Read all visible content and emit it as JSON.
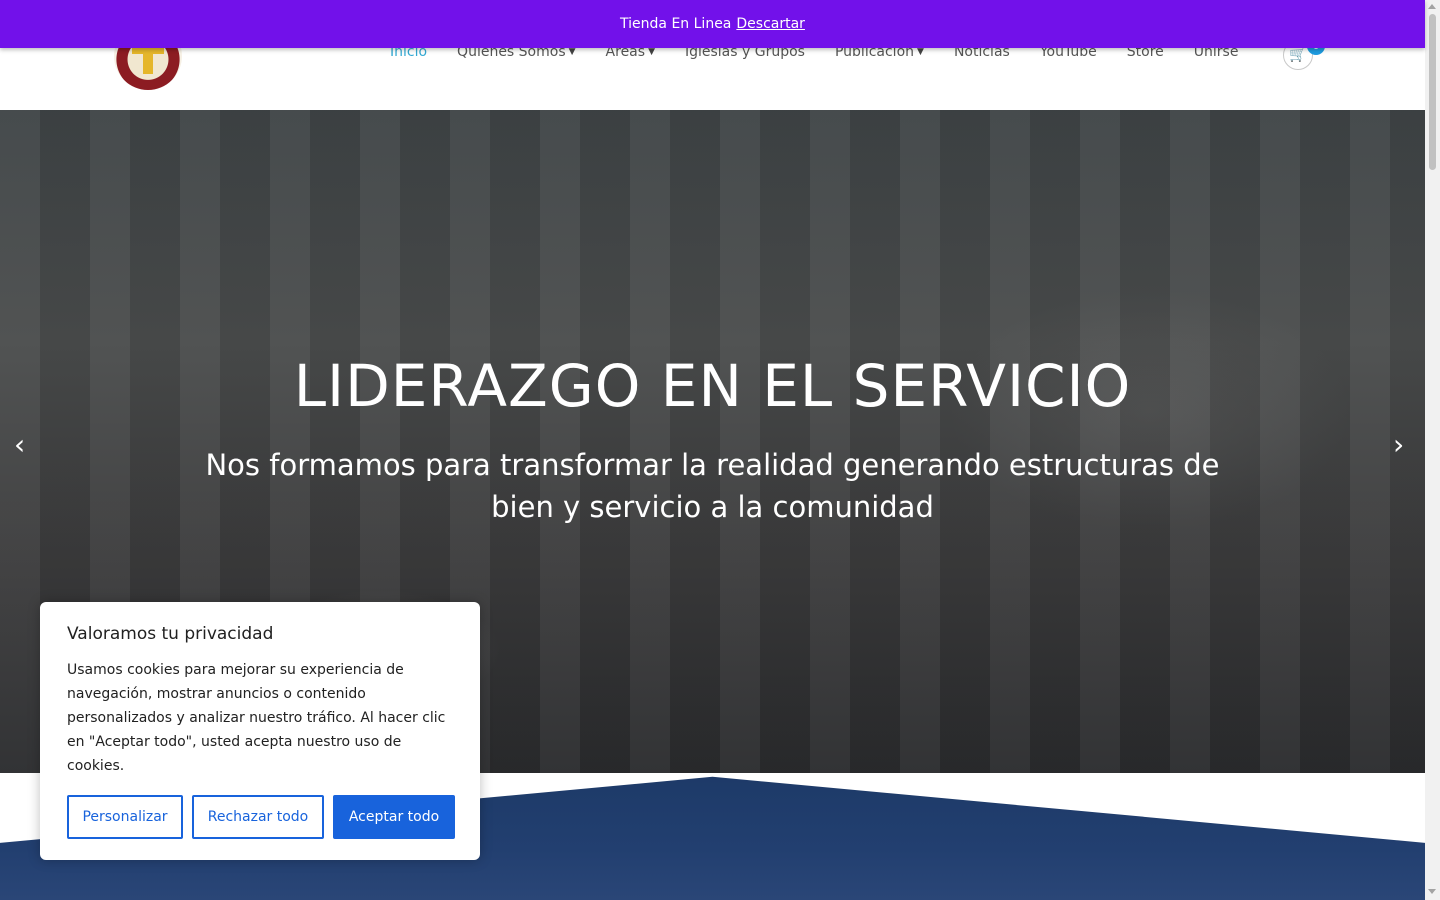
{
  "promo": {
    "text": "Tienda En Linea",
    "dismiss_label": "Descartar"
  },
  "nav": {
    "items": [
      {
        "label": "Inicio",
        "active": true,
        "dropdown": false
      },
      {
        "label": "Quienes Somos",
        "active": false,
        "dropdown": true
      },
      {
        "label": "Areas",
        "active": false,
        "dropdown": true
      },
      {
        "label": "Iglesias y Grupos",
        "active": false,
        "dropdown": false
      },
      {
        "label": "Publicación",
        "active": false,
        "dropdown": true
      },
      {
        "label": "Noticias",
        "active": false,
        "dropdown": false
      },
      {
        "label": "YouTube",
        "active": false,
        "dropdown": false
      },
      {
        "label": "Store",
        "active": false,
        "dropdown": false
      },
      {
        "label": "Unirse",
        "active": false,
        "dropdown": false
      }
    ],
    "cart_count": "0"
  },
  "hero": {
    "title": "LIDERAZGO EN EL SERVICIO",
    "subtitle": "Nos formamos para transformar la realidad generando estructuras de bien y servicio a la comunidad",
    "prev_icon": "‹",
    "next_icon": "›"
  },
  "cookie": {
    "title": "Valoramos tu privacidad",
    "text": "Usamos cookies para mejorar su experiencia de navegación, mostrar anuncios o contenido personalizados y analizar nuestro tráfico. Al hacer clic en \"Aceptar todo\", usted acepta nuestro uso de cookies.",
    "customize_label": "Personalizar",
    "reject_label": "Rechazar todo",
    "accept_label": "Aceptar todo"
  },
  "colors": {
    "promo_bg": "#7211ea",
    "nav_active": "#33a9d3",
    "cookie_primary": "#1863dc",
    "section_blue": "#223f70"
  }
}
